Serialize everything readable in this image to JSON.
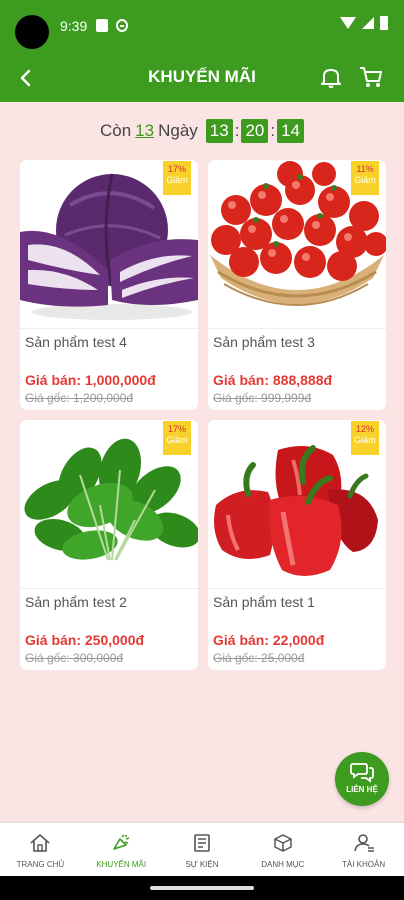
{
  "status_bar": {
    "time": "9:39"
  },
  "header": {
    "title": "KHUYẾN MÃI"
  },
  "countdown": {
    "prefix": "Còn",
    "days": "13",
    "days_label": "Ngày",
    "hours": "13",
    "minutes": "20",
    "seconds": "14",
    "separator": ":"
  },
  "products": [
    {
      "name": "Sản phẩm test 4",
      "price": "Giá bán: 1,000,000đ",
      "original": "Giá gốc: 1,200,000đ",
      "discount": "17%",
      "discount_label": "Giảm",
      "image": "red-cabbage"
    },
    {
      "name": "Sản phẩm test 3",
      "price": "Giá bán: 888,888đ",
      "original": "Giá gốc: 999,999đ",
      "discount": "11%",
      "discount_label": "Giảm",
      "image": "cherry-tomatoes"
    },
    {
      "name": "Sản phẩm test 2",
      "price": "Giá bán: 250,000đ",
      "original": "Giá gốc: 300,000đ",
      "discount": "17%",
      "discount_label": "Giảm",
      "image": "spinach"
    },
    {
      "name": "Sản phẩm test 1",
      "price": "Giá bán: 22,000đ",
      "original": "Giá gốc: 25,000đ",
      "discount": "12%",
      "discount_label": "Giảm",
      "image": "red-peppers"
    }
  ],
  "chat": {
    "label": "LIÊN HỆ"
  },
  "bottom_nav": [
    {
      "label": "TRANG CHỦ",
      "icon": "home-icon"
    },
    {
      "label": "KHUYẾN MÃI",
      "icon": "promotion-icon"
    },
    {
      "label": "SỰ KIỆN",
      "icon": "event-icon"
    },
    {
      "label": "DANH MỤC",
      "icon": "category-icon"
    },
    {
      "label": "TÀI KHOẢN",
      "icon": "account-icon"
    }
  ],
  "colors": {
    "primary": "#3d9b1f",
    "background": "#fbe4e4",
    "price": "#e53935",
    "badge": "#f8d22a"
  }
}
